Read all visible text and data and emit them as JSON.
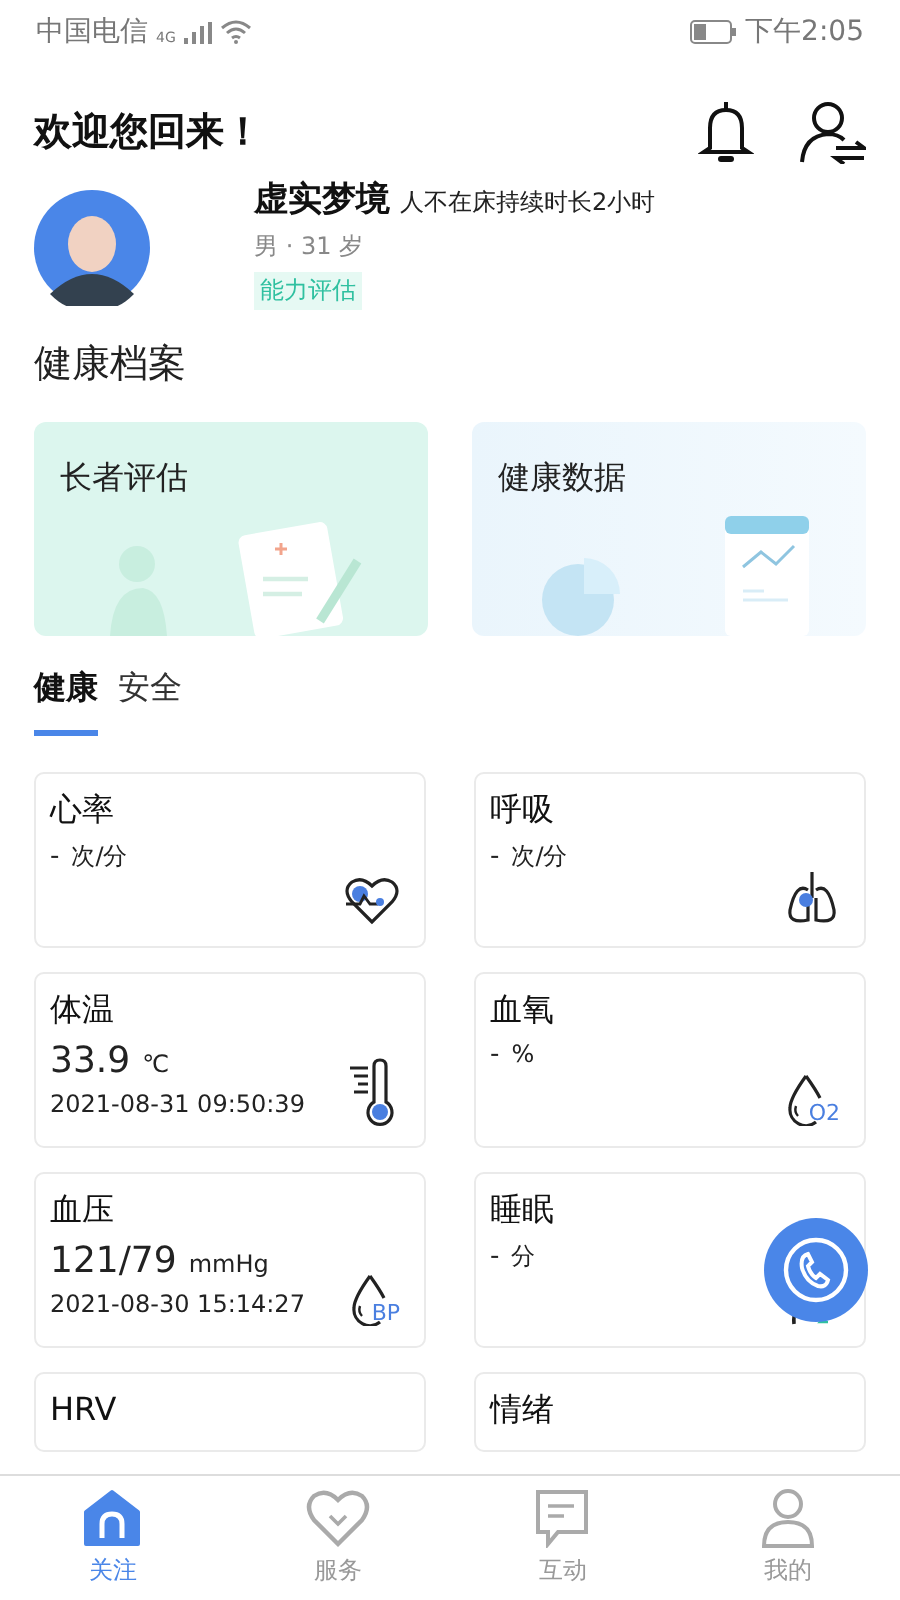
{
  "status_bar": {
    "carrier": "中国电信",
    "network": "4G",
    "time": "下午2:05"
  },
  "header": {
    "greeting": "欢迎您回来！"
  },
  "profile": {
    "name": "虚实梦境",
    "status": "人不在床持续时长2小时",
    "info": "男 · 31 岁",
    "tag": "能力评估"
  },
  "section_title": "健康档案",
  "archive_cards": [
    {
      "title": "长者评估",
      "kind": "assessment"
    },
    {
      "title": "健康数据",
      "kind": "data"
    }
  ],
  "tabs": [
    {
      "label": "健康",
      "selected": true
    },
    {
      "label": "安全",
      "selected": false
    }
  ],
  "metrics": [
    {
      "title": "心率",
      "value": "-",
      "unit": "次/分",
      "kind": "heart"
    },
    {
      "title": "呼吸",
      "value": "-",
      "unit": "次/分",
      "kind": "lungs"
    },
    {
      "title": "体温",
      "value": "33.9",
      "unit": "℃",
      "time": "2021-08-31 09:50:39",
      "kind": "thermometer"
    },
    {
      "title": "血氧",
      "value": "-",
      "unit": "%",
      "kind": "oxygen",
      "icon_text": "O2"
    },
    {
      "title": "血压",
      "value": "121/79",
      "unit": "mmHg",
      "time": "2021-08-30 15:14:27",
      "kind": "bp",
      "icon_text": "BP"
    },
    {
      "title": "睡眠",
      "value": "-",
      "unit": "分",
      "kind": "sleep"
    },
    {
      "title": "HRV",
      "kind": "partial"
    },
    {
      "title": "情绪",
      "kind": "partial"
    }
  ],
  "nav": [
    {
      "label": "关注",
      "kind": "home",
      "selected": true
    },
    {
      "label": "服务",
      "kind": "heart",
      "selected": false
    },
    {
      "label": "互动",
      "kind": "chat",
      "selected": false
    },
    {
      "label": "我的",
      "kind": "user",
      "selected": false
    }
  ]
}
